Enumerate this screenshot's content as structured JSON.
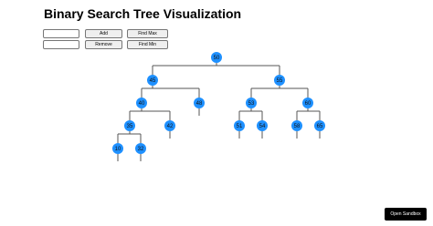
{
  "title": "Binary Search Tree Visualization",
  "controls": {
    "row1": {
      "input_value": "",
      "add_label": "Add",
      "find_max_label": "Find Max"
    },
    "row2": {
      "input_value": "",
      "remove_label": "Remove",
      "find_min_label": "Find Min"
    }
  },
  "tree": {
    "node_color": "#1e90ff",
    "line_color": "#555555",
    "nodes": [
      {
        "id": "n50",
        "value": "50",
        "parent": null
      },
      {
        "id": "n45",
        "value": "45",
        "parent": "n50"
      },
      {
        "id": "n55",
        "value": "55",
        "parent": "n50"
      },
      {
        "id": "n40",
        "value": "40",
        "parent": "n45"
      },
      {
        "id": "n48",
        "value": "48",
        "parent": "n45"
      },
      {
        "id": "n53",
        "value": "53",
        "parent": "n55"
      },
      {
        "id": "n60",
        "value": "60",
        "parent": "n55"
      },
      {
        "id": "n35",
        "value": "35",
        "parent": "n40"
      },
      {
        "id": "n42",
        "value": "42",
        "parent": "n40"
      },
      {
        "id": "n51",
        "value": "51",
        "parent": "n53"
      },
      {
        "id": "n54",
        "value": "54",
        "parent": "n53"
      },
      {
        "id": "n58",
        "value": "58",
        "parent": "n60"
      },
      {
        "id": "n65",
        "value": "65",
        "parent": "n60"
      },
      {
        "id": "n10",
        "value": "10",
        "parent": "n35"
      },
      {
        "id": "n32",
        "value": "32",
        "parent": "n35"
      }
    ]
  },
  "sandbox_label": "Open Sandbox"
}
